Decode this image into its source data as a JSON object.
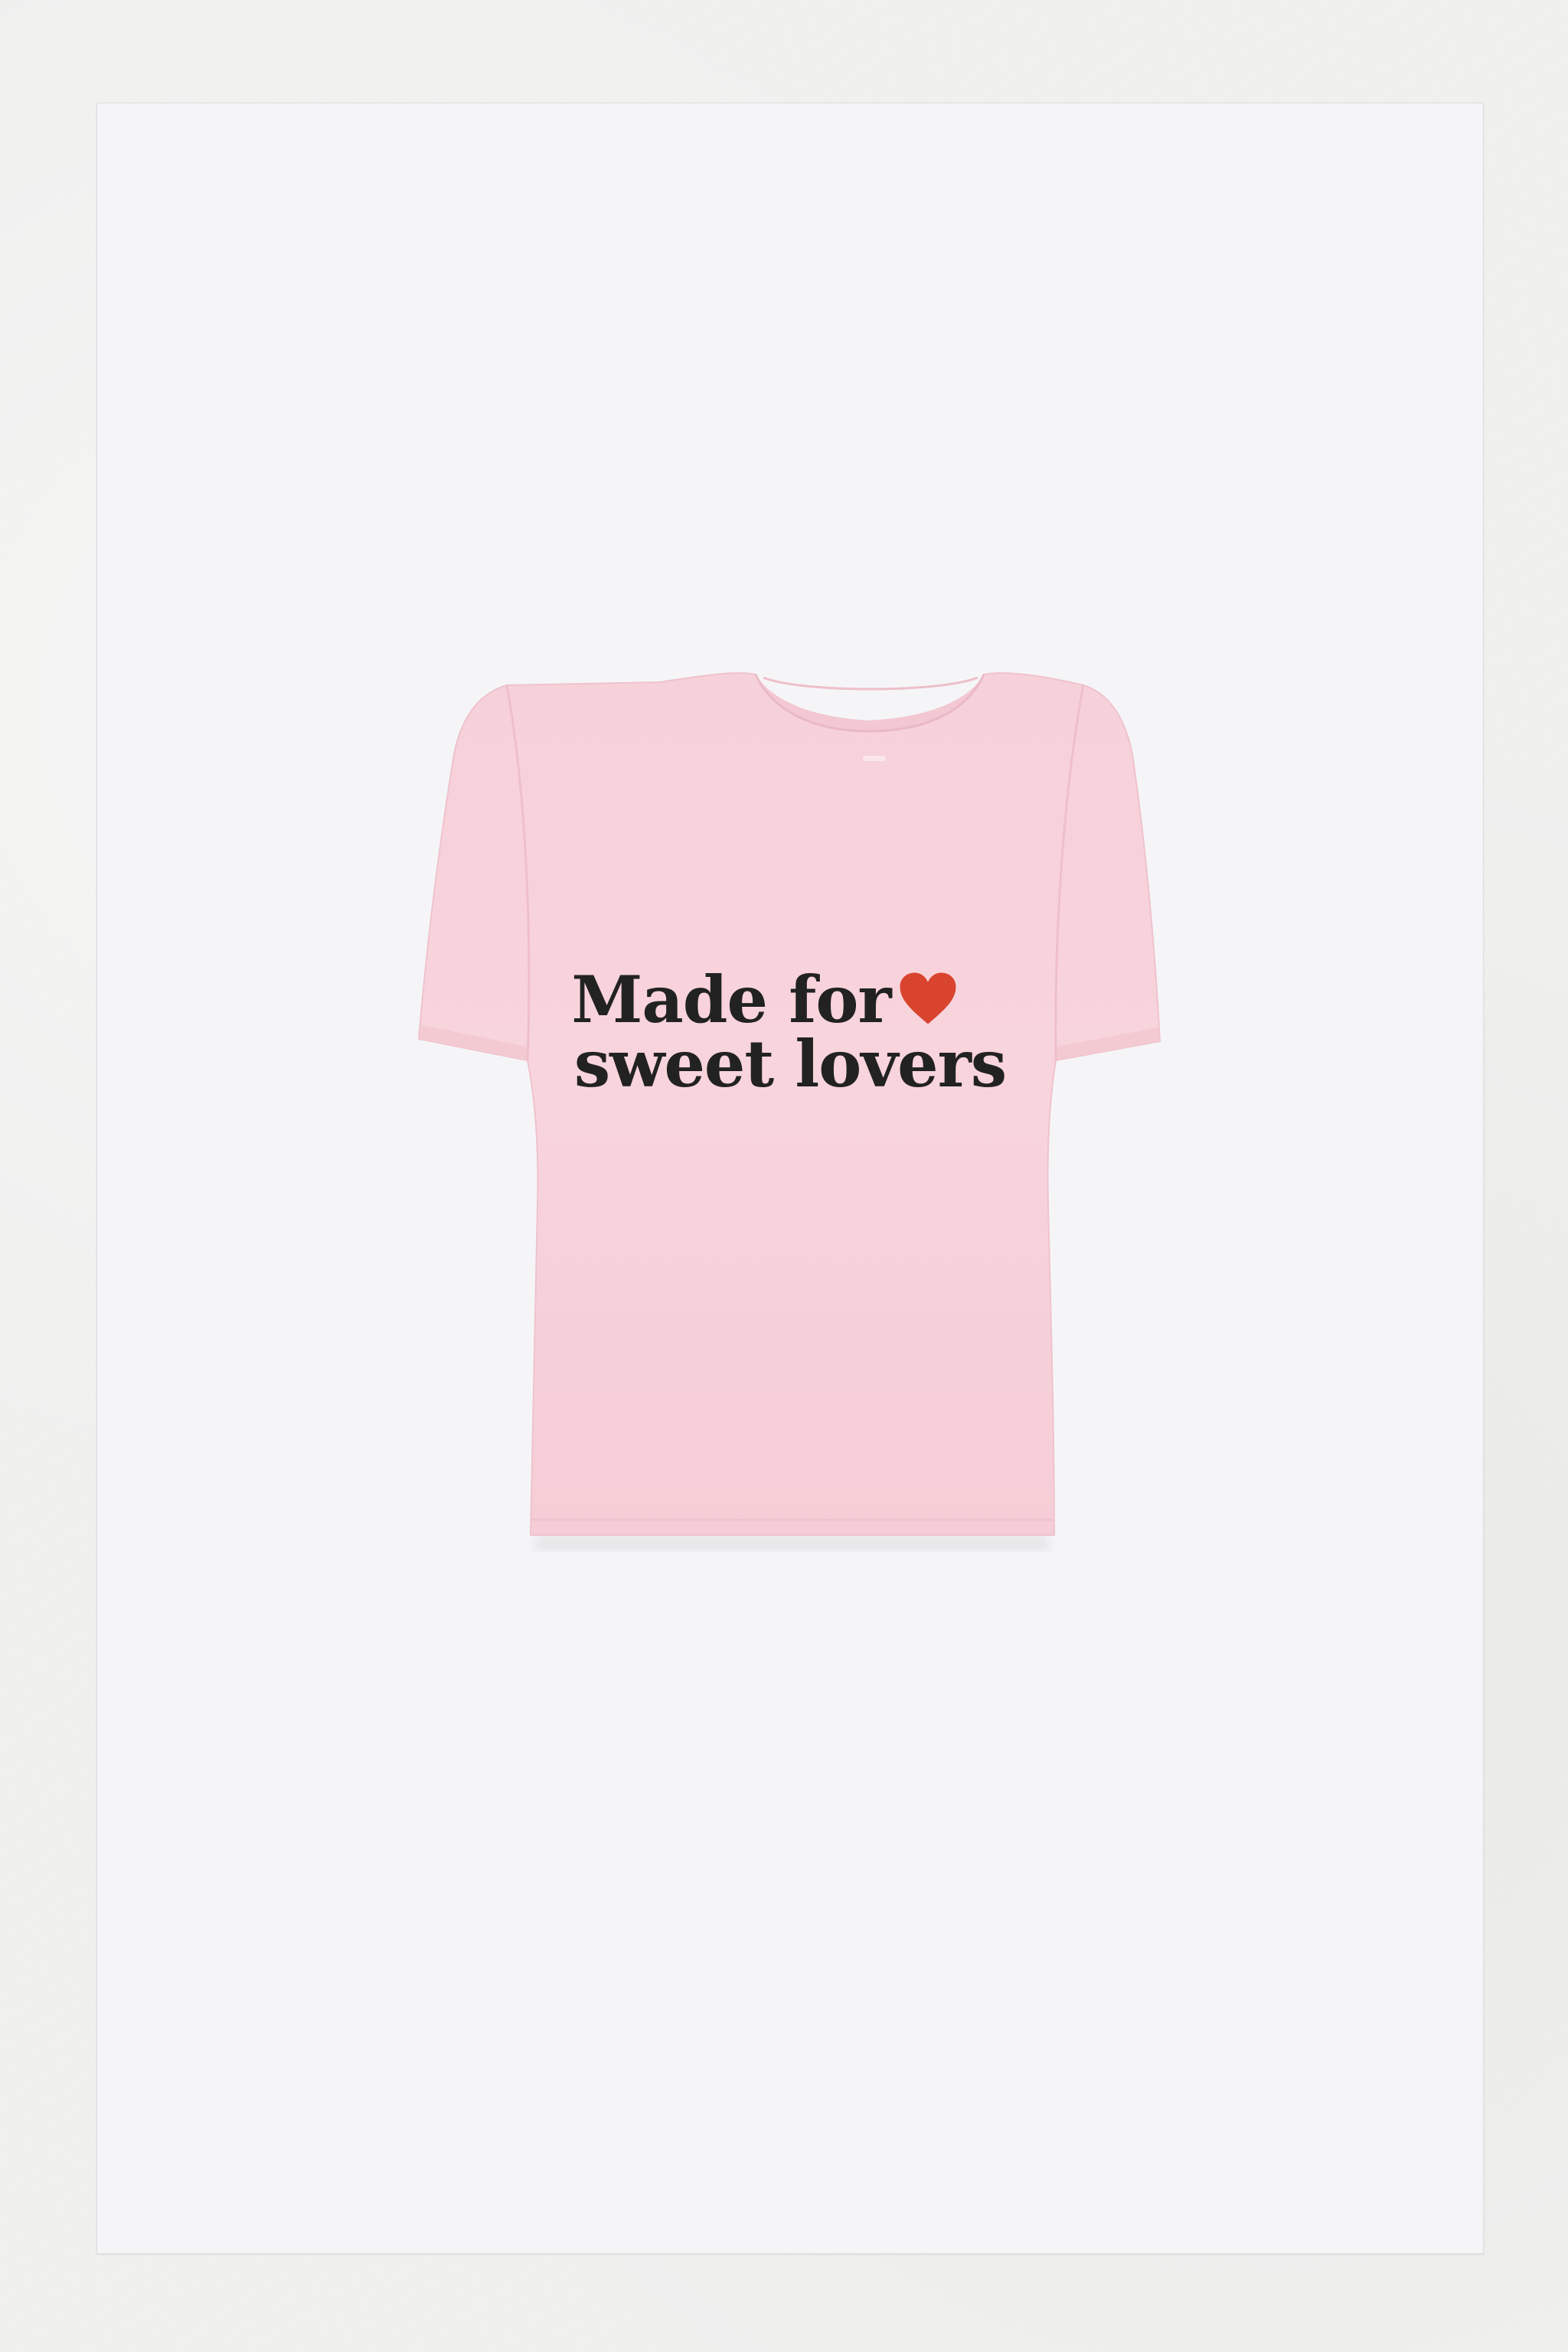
{
  "photo": {
    "subject": "pink t-shirt",
    "colors": {
      "background": "#f1f1f0",
      "card": "#f5f5f7",
      "shirt": "#f8d4dc",
      "print_text": "#222222",
      "heart": "#d9442f"
    }
  },
  "shirt_print": {
    "line1": "Made for",
    "line2": "sweet lovers",
    "icon": "heart-icon"
  }
}
